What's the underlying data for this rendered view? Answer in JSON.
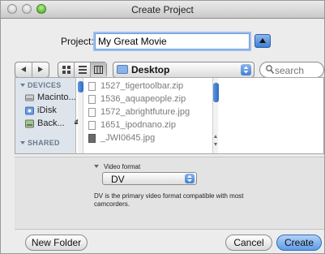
{
  "window": {
    "title": "Create Project"
  },
  "project": {
    "label": "Project:",
    "value": "My Great Movie"
  },
  "toolbar": {
    "location": "Desktop",
    "search_placeholder": "search"
  },
  "sidebar": {
    "devices_header": "DEVICES",
    "items": [
      {
        "label": "Macinto...",
        "icon": "hard-drive-icon"
      },
      {
        "label": "iDisk",
        "icon": "idisk-icon"
      },
      {
        "label": "Back...",
        "icon": "backup-drive-icon"
      }
    ],
    "shared_header": "SHARED"
  },
  "files": [
    {
      "name": "1527_tigertoolbar.zip",
      "type": "zip"
    },
    {
      "name": "1536_aquapeople.zip",
      "type": "zip"
    },
    {
      "name": "1572_abrightfuture.jpg",
      "type": "jpg"
    },
    {
      "name": "1651_ipodnano.zip",
      "type": "zip"
    },
    {
      "name": "_JWI0645.jpg",
      "type": "jpg"
    }
  ],
  "format": {
    "label": "Video format",
    "value": "DV",
    "description": "DV is the primary video format compatible with most camcorders."
  },
  "buttons": {
    "new_folder": "New Folder",
    "cancel": "Cancel",
    "create": "Create"
  },
  "colors": {
    "accent": "#3f7fd6",
    "default_button": "#5e9be7"
  }
}
